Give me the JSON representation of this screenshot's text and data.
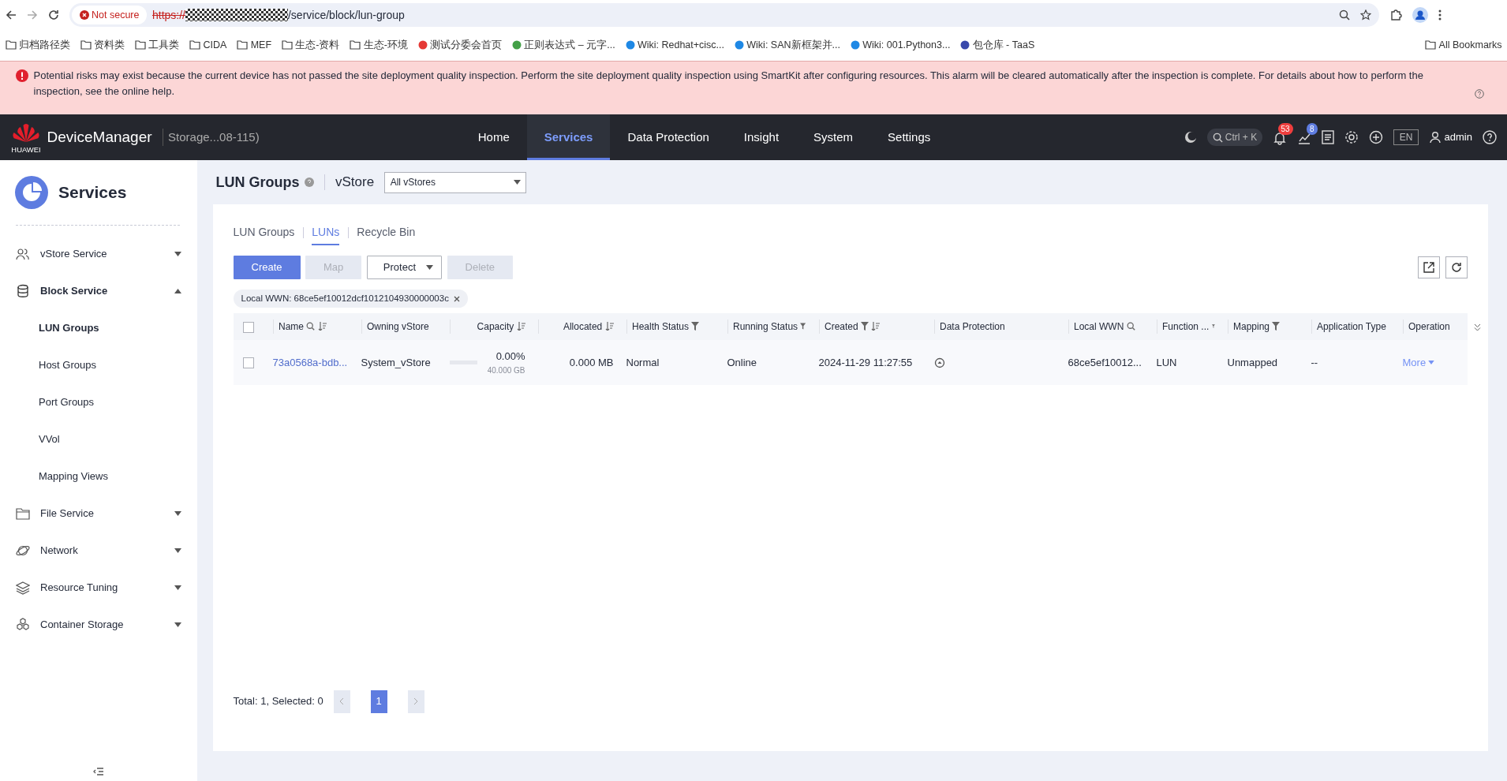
{
  "browser": {
    "security_label": "Not secure",
    "url_scheme": "https://",
    "url_path": "/service/block/lun-group",
    "all_bookmarks": "All Bookmarks",
    "bookmarks": [
      {
        "label": "归档路径类",
        "kind": "folder"
      },
      {
        "label": "资料类",
        "kind": "folder"
      },
      {
        "label": "工具类",
        "kind": "folder"
      },
      {
        "label": "CIDA",
        "kind": "folder"
      },
      {
        "label": "MEF",
        "kind": "folder"
      },
      {
        "label": "生态-资料",
        "kind": "folder"
      },
      {
        "label": "生态-环境",
        "kind": "folder"
      },
      {
        "label": "测试分委会首页",
        "kind": "site",
        "color": "#e53935"
      },
      {
        "label": "正则表达式 – 元字...",
        "kind": "site",
        "color": "#43a047"
      },
      {
        "label": "Wiki: Redhat+cisc...",
        "kind": "site",
        "color": "#1e88e5"
      },
      {
        "label": "Wiki: SAN新框架并...",
        "kind": "site",
        "color": "#1e88e5"
      },
      {
        "label": "Wiki: 001.Python3...",
        "kind": "site",
        "color": "#1e88e5"
      },
      {
        "label": "包仓库 - TaaS",
        "kind": "site",
        "color": "#3949ab"
      }
    ]
  },
  "alert": {
    "text": "Potential risks may exist because the current device has not passed the site deployment quality inspection. Perform the site deployment quality inspection using SmartKit after configuring resources. This alarm will be cleared automatically after the inspection is complete. For details about how to perform the inspection, see the online help."
  },
  "header": {
    "brand": "DeviceManager",
    "brand_sub": "HUAWEI",
    "device": "Storage...08-115)",
    "nav": [
      {
        "label": "Home",
        "selected": false
      },
      {
        "label": "Services",
        "selected": true
      },
      {
        "label": "Data Protection",
        "selected": false
      },
      {
        "label": "Insight",
        "selected": false
      },
      {
        "label": "System",
        "selected": false
      },
      {
        "label": "Settings",
        "selected": false
      }
    ],
    "search_hint": "Ctrl + K",
    "alarm_count": "53",
    "task_count": "8",
    "language": "EN",
    "user": "admin"
  },
  "sidebar": {
    "title": "Services",
    "items": [
      {
        "label": "vStore Service",
        "expanded": false
      },
      {
        "label": "Block Service",
        "expanded": true,
        "children": [
          {
            "label": "LUN Groups",
            "selected": true
          },
          {
            "label": "Host Groups",
            "selected": false
          },
          {
            "label": "Port Groups",
            "selected": false
          },
          {
            "label": "VVol",
            "selected": false
          },
          {
            "label": "Mapping Views",
            "selected": false
          }
        ]
      },
      {
        "label": "File Service",
        "expanded": false
      },
      {
        "label": "Network",
        "expanded": false
      },
      {
        "label": "Resource Tuning",
        "expanded": false
      },
      {
        "label": "Container Storage",
        "expanded": false
      }
    ]
  },
  "page": {
    "title": "LUN Groups",
    "vstore_label": "vStore",
    "vstore_value": "All vStores"
  },
  "tabs": [
    {
      "label": "LUN Groups",
      "selected": false
    },
    {
      "label": "LUNs",
      "selected": true
    },
    {
      "label": "Recycle Bin",
      "selected": false
    }
  ],
  "buttons": [
    {
      "label": "Create",
      "kind": "primary",
      "disabled": false
    },
    {
      "label": "Map",
      "kind": "primary",
      "disabled": true
    },
    {
      "label": "Protect",
      "kind": "dropdown",
      "disabled": false
    },
    {
      "label": "Delete",
      "kind": "default",
      "disabled": true
    }
  ],
  "filter_tag": "Local WWN: 68ce5ef10012dcf1012104930000003c",
  "table": {
    "all_selected": false,
    "columns": [
      {
        "label": "Name",
        "search": true,
        "filter": false,
        "sort": true
      },
      {
        "label": "Owning vStore",
        "search": false,
        "filter": false,
        "sort": false
      },
      {
        "label": "Capacity",
        "search": false,
        "filter": false,
        "sort": true
      },
      {
        "label": "Allocated",
        "search": false,
        "filter": false,
        "sort": true
      },
      {
        "label": "Health Status",
        "search": false,
        "filter": true,
        "sort": false
      },
      {
        "label": "Running Status",
        "search": false,
        "filter": true,
        "sort": false
      },
      {
        "label": "Created",
        "search": false,
        "filter": true,
        "sort": true
      },
      {
        "label": "Data Protection",
        "search": false,
        "filter": false,
        "sort": false
      },
      {
        "label": "Local WWN",
        "search": true,
        "filter": false,
        "sort": false
      },
      {
        "label": "Function ...",
        "search": false,
        "filter": true,
        "sort": false
      },
      {
        "label": "Mapping",
        "search": false,
        "filter": true,
        "sort": false
      },
      {
        "label": "Application Type",
        "search": false,
        "filter": false,
        "sort": false
      },
      {
        "label": "Operation",
        "search": false,
        "filter": false,
        "sort": false
      }
    ],
    "rows": [
      {
        "selected": false,
        "name": "73a0568a-bdb...",
        "owning_vstore": "System_vStore",
        "capacity_percent": "0.00%",
        "capacity_total": "40.000 GB",
        "level": 0,
        "allocated": "0.000 MB",
        "health_status": "Normal",
        "running_status": "Online",
        "created": "2024-11-29 11:27:55",
        "protected": true,
        "local_wwn": "68ce5ef10012...",
        "function": "LUN",
        "mapping": "Unmapped",
        "application_type": "--",
        "operation": "More"
      }
    ]
  },
  "pagination": {
    "summary": "Total: 1, Selected: 0",
    "pages": [
      {
        "label": "1",
        "selected": true
      }
    ]
  }
}
